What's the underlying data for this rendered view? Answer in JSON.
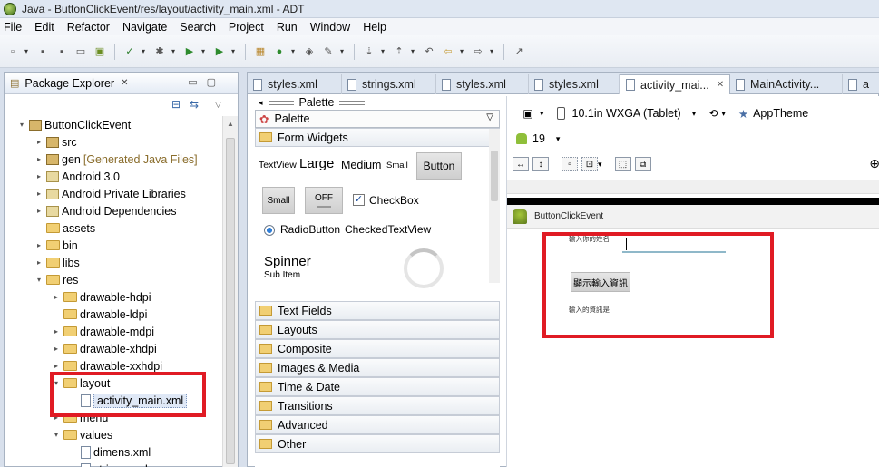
{
  "window": {
    "title": "Java - ButtonClickEvent/res/layout/activity_main.xml - ADT"
  },
  "menu": [
    "File",
    "Edit",
    "Refactor",
    "Navigate",
    "Search",
    "Project",
    "Run",
    "Window",
    "Help"
  ],
  "package_explorer": {
    "title": "Package Explorer",
    "tree": [
      {
        "label": "ButtonClickEvent",
        "level": 0,
        "arrow": "▾",
        "icon": "project"
      },
      {
        "label": "src",
        "level": 1,
        "arrow": "▸",
        "icon": "pkg"
      },
      {
        "label": "gen",
        "suffix": "[Generated Java Files]",
        "level": 1,
        "arrow": "▸",
        "icon": "pkg"
      },
      {
        "label": "Android 3.0",
        "level": 1,
        "arrow": "▸",
        "icon": "lib"
      },
      {
        "label": "Android Private Libraries",
        "level": 1,
        "arrow": "▸",
        "icon": "lib"
      },
      {
        "label": "Android Dependencies",
        "level": 1,
        "arrow": "▸",
        "icon": "lib"
      },
      {
        "label": "assets",
        "level": 1,
        "arrow": "",
        "icon": "folder"
      },
      {
        "label": "bin",
        "level": 1,
        "arrow": "▸",
        "icon": "folder"
      },
      {
        "label": "libs",
        "level": 1,
        "arrow": "▸",
        "icon": "folder"
      },
      {
        "label": "res",
        "level": 1,
        "arrow": "▾",
        "icon": "folder"
      },
      {
        "label": "drawable-hdpi",
        "level": 2,
        "arrow": "▸",
        "icon": "folder"
      },
      {
        "label": "drawable-ldpi",
        "level": 2,
        "arrow": "",
        "icon": "folder"
      },
      {
        "label": "drawable-mdpi",
        "level": 2,
        "arrow": "▸",
        "icon": "folder"
      },
      {
        "label": "drawable-xhdpi",
        "level": 2,
        "arrow": "▸",
        "icon": "folder"
      },
      {
        "label": "drawable-xxhdpi",
        "level": 2,
        "arrow": "▸",
        "icon": "folder"
      },
      {
        "label": "layout",
        "level": 2,
        "arrow": "▾",
        "icon": "folder"
      },
      {
        "label": "activity_main.xml",
        "level": 3,
        "arrow": "",
        "icon": "file",
        "selected": true
      },
      {
        "label": "menu",
        "level": 2,
        "arrow": "▸",
        "icon": "folder"
      },
      {
        "label": "values",
        "level": 2,
        "arrow": "▾",
        "icon": "folder"
      },
      {
        "label": "dimens.xml",
        "level": 3,
        "arrow": "",
        "icon": "file"
      },
      {
        "label": "strings.xml",
        "level": 3,
        "arrow": "",
        "icon": "file"
      }
    ]
  },
  "editor_tabs": [
    "styles.xml",
    "strings.xml",
    "styles.xml",
    "styles.xml",
    "activity_mai...",
    "MainActivity...",
    "a"
  ],
  "palette": {
    "title": "Palette",
    "selector": "Palette",
    "widgets_category": "Form Widgets",
    "textview_label": "TextView",
    "large": "Large",
    "medium": "Medium",
    "small": "Small",
    "button": "Button",
    "small_button": "Small",
    "toggle_off": "OFF",
    "checkbox": "CheckBox",
    "radiobutton": "RadioButton",
    "checkedtextview": "CheckedTextView",
    "spinner": "Spinner",
    "sub_item": "Sub Item",
    "categories": [
      "Text Fields",
      "Layouts",
      "Composite",
      "Images & Media",
      "Time & Date",
      "Transitions",
      "Advanced",
      "Other"
    ]
  },
  "canvas": {
    "device": "10.1in WXGA (Tablet)",
    "theme": "AppTheme",
    "api": "19",
    "app_name": "ButtonClickEvent",
    "name_prompt": "輸入你的姓名",
    "show_button": "顯示輸入資訊",
    "result_label": "輸入的資訊是"
  },
  "colors": {
    "highlight": "#e01b24",
    "folder": "#f1cf73",
    "input_underline": "#8fb8c9"
  }
}
